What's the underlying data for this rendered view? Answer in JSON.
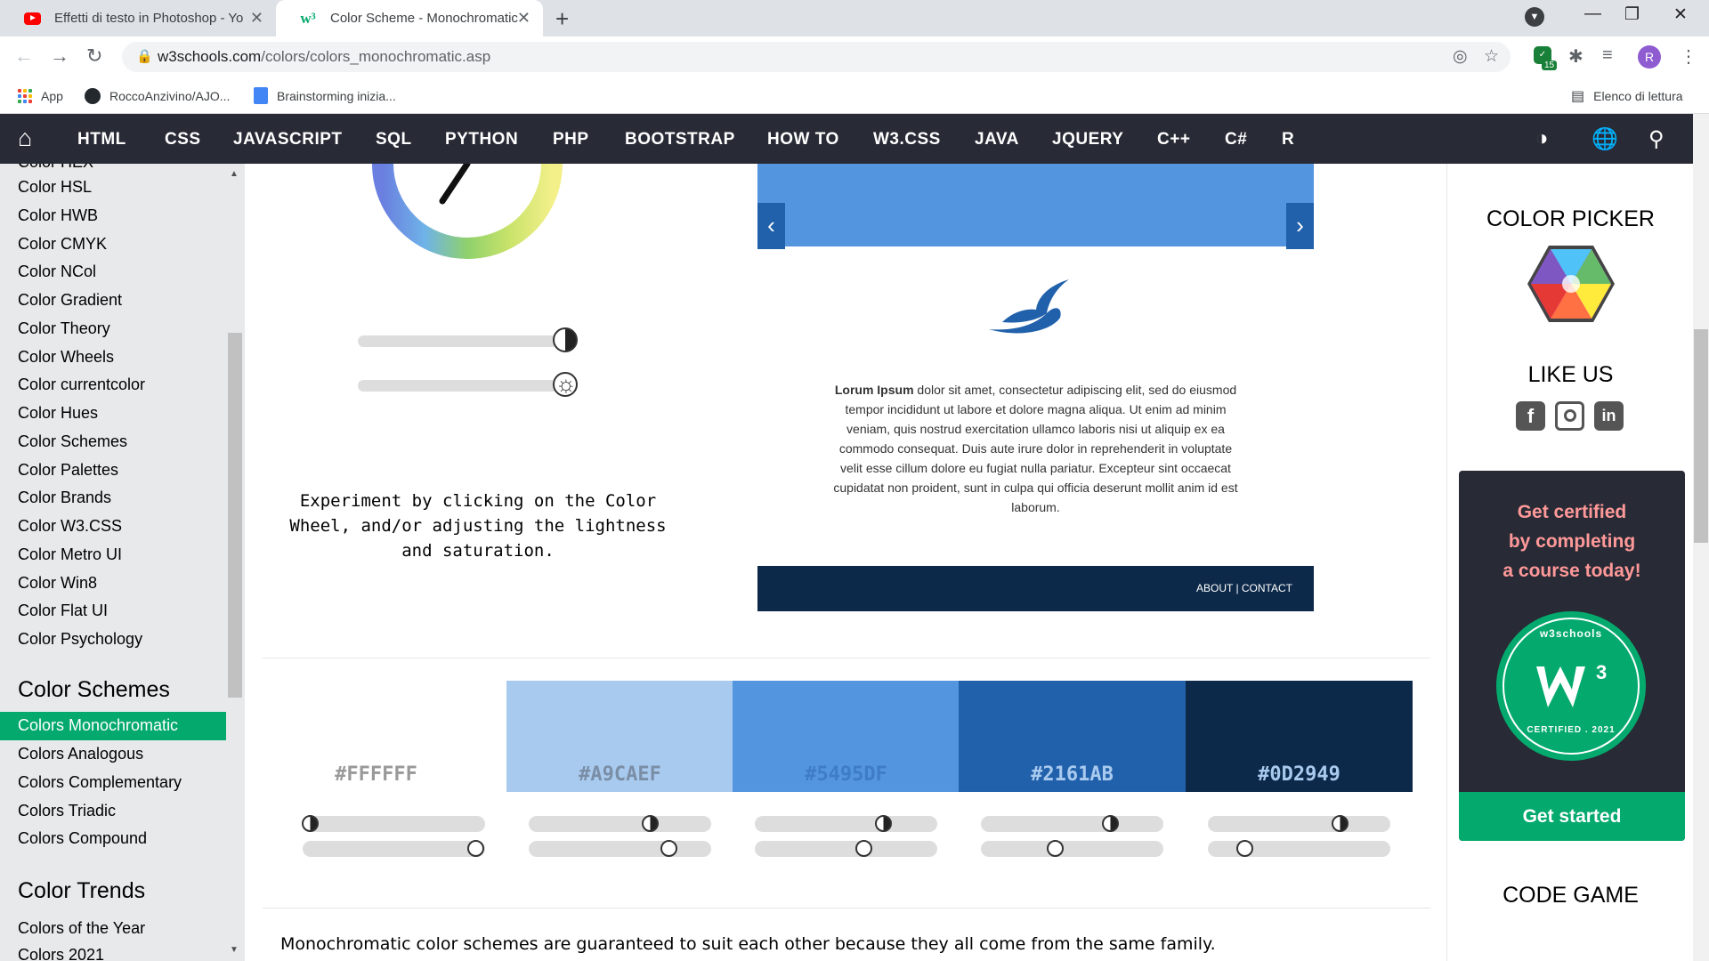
{
  "browser": {
    "tabs": [
      {
        "title": "Effetti di testo in Photoshop - Yo",
        "favicon": "youtube-icon"
      },
      {
        "title": "Color Scheme - Monochromatic",
        "favicon": "w3schools-icon"
      }
    ],
    "url_host": "w3schools.com",
    "url_path": "/colors/colors_monochromatic.asp",
    "extension_badge": "15",
    "profile_initial": "R",
    "bookmarks": [
      {
        "label": "App",
        "icon": "apps-grid-icon"
      },
      {
        "label": "RoccoAnzivino/AJO...",
        "icon": "github-icon"
      },
      {
        "label": "Brainstorming inizia...",
        "icon": "docs-icon"
      }
    ],
    "reading_list": "Elenco di lettura"
  },
  "topnav": {
    "items": [
      "HTML",
      "CSS",
      "JAVASCRIPT",
      "SQL",
      "PYTHON",
      "PHP",
      "BOOTSTRAP",
      "HOW TO",
      "W3.CSS",
      "JAVA",
      "JQUERY",
      "C++",
      "C#",
      "R"
    ]
  },
  "sidebar": {
    "cut_item": "Color HEX",
    "items": [
      "Color HSL",
      "Color HWB",
      "Color CMYK",
      "Color NCol",
      "Color Gradient",
      "Color Theory",
      "Color Wheels",
      "Color currentcolor",
      "Color Hues",
      "Color Schemes",
      "Color Palettes",
      "Color Brands",
      "Color W3.CSS",
      "Color Metro UI",
      "Color Win8",
      "Color Flat UI",
      "Color Psychology"
    ],
    "section2_title": "Color Schemes",
    "section2_items": [
      "Colors Monochromatic",
      "Colors Analogous",
      "Colors Complementary",
      "Colors Triadic",
      "Colors Compound"
    ],
    "section3_title": "Color Trends",
    "section3_items": [
      "Colors of the Year",
      "Colors 2021"
    ]
  },
  "main": {
    "experiment_text": "Experiment by clicking on the Color Wheel, and/or adjusting the lightness and saturation.",
    "demo": {
      "lorem_bold": "Lorum Ipsum",
      "lorem_rest": " dolor sit amet, consectetur adipiscing elit, sed do eiusmod tempor incididunt ut labore et dolore magna aliqua. Ut enim ad minim veniam, quis nostrud exercitation ullamco laboris nisi ut aliquip ex ea commodo consequat. Duis aute irure dolor in reprehenderit in voluptate velit esse cillum dolore eu fugiat nulla pariatur. Excepteur sint occaecat cupidatat non proident, sunt in culpa qui officia deserunt mollit anim id est laborum.",
      "footer_links": "ABOUT | CONTACT",
      "prev_arrow": "‹",
      "next_arrow": "›"
    },
    "swatches": [
      {
        "hex": "#FFFFFF",
        "label_color": "#999999"
      },
      {
        "hex": "#A9CAEF",
        "label_color": "#7a8ea6"
      },
      {
        "hex": "#5495DF",
        "label_color": "#3f7cc7"
      },
      {
        "hex": "#2161AB",
        "label_color": "#a9caef"
      },
      {
        "hex": "#0D2949",
        "label_color": "#a9caef"
      }
    ],
    "bottom_text": "Monochromatic color schemes are guaranteed to suit each other because they all come from the same family."
  },
  "right": {
    "color_picker_title": "COLOR PICKER",
    "like_us_title": "LIKE US",
    "cert_lines": [
      "Get certified",
      "by completing",
      "a course today!"
    ],
    "cert_badge_top": "w3schools",
    "cert_badge_bottom": "CERTIFIED . 2021",
    "cert_button": "Get started",
    "code_game_title": "CODE GAME"
  }
}
